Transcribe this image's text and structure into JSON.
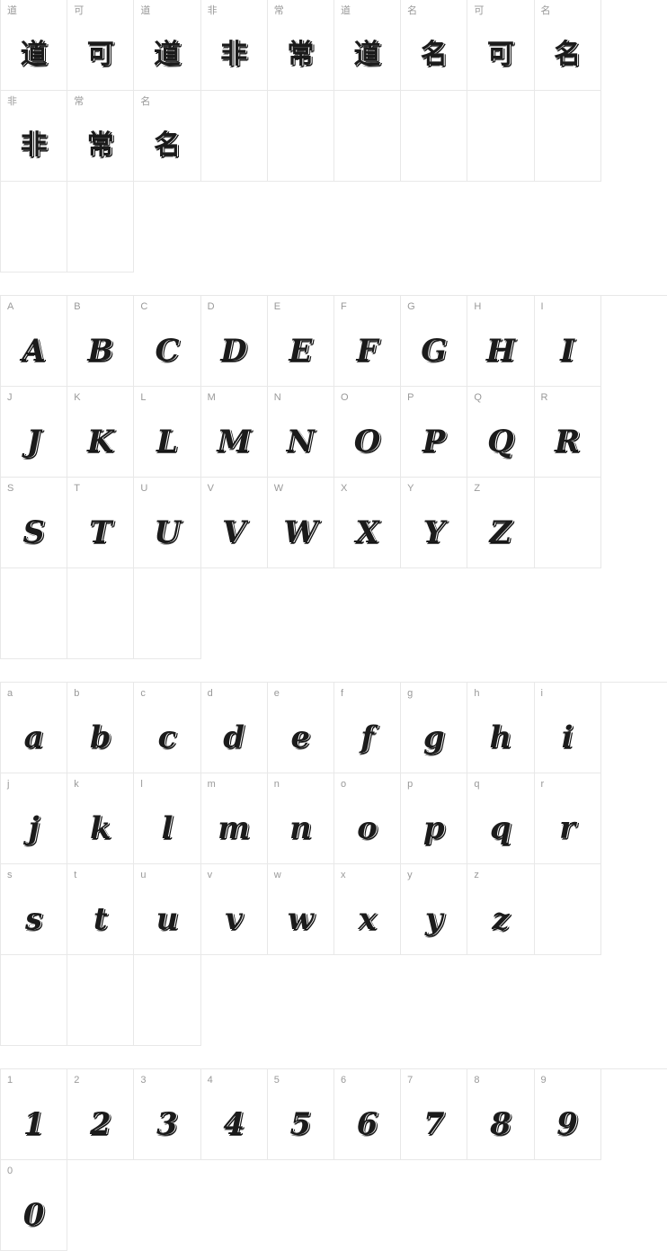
{
  "page": {
    "title": "Font character map preview",
    "background": "#ffffff",
    "grid_line_color": "#e8e8e8",
    "label_color": "#999999",
    "glyph_color": "#1b1b1b"
  },
  "blocks": [
    {
      "name": "cjk-sample-block",
      "columns": 10,
      "cells": [
        {
          "label": "道",
          "glyph": "道",
          "script": "cjk"
        },
        {
          "label": "可",
          "glyph": "可",
          "script": "cjk"
        },
        {
          "label": "道",
          "glyph": "道",
          "script": "cjk"
        },
        {
          "label": "非",
          "glyph": "非",
          "script": "cjk"
        },
        {
          "label": "常",
          "glyph": "常",
          "script": "cjk"
        },
        {
          "label": "道",
          "glyph": "道",
          "script": "cjk"
        },
        {
          "label": "名",
          "glyph": "名",
          "script": "cjk"
        },
        {
          "label": "可",
          "glyph": "可",
          "script": "cjk"
        },
        {
          "label": "名",
          "glyph": "名",
          "script": "cjk"
        },
        {
          "label": "非",
          "glyph": "非",
          "script": "cjk"
        },
        {
          "label": "常",
          "glyph": "常",
          "script": "cjk"
        },
        {
          "label": "名",
          "glyph": "名",
          "script": "cjk"
        },
        {
          "label": "",
          "glyph": "",
          "script": "empty"
        },
        {
          "label": "",
          "glyph": "",
          "script": "empty"
        },
        {
          "label": "",
          "glyph": "",
          "script": "empty"
        },
        {
          "label": "",
          "glyph": "",
          "script": "empty"
        },
        {
          "label": "",
          "glyph": "",
          "script": "empty"
        },
        {
          "label": "",
          "glyph": "",
          "script": "empty"
        },
        {
          "label": "",
          "glyph": "",
          "script": "empty"
        },
        {
          "label": "",
          "glyph": "",
          "script": "empty"
        }
      ]
    },
    {
      "name": "uppercase-block",
      "columns": 10,
      "cells": [
        {
          "label": "A",
          "glyph": "A",
          "script": "latin"
        },
        {
          "label": "B",
          "glyph": "B",
          "script": "latin"
        },
        {
          "label": "C",
          "glyph": "C",
          "script": "latin"
        },
        {
          "label": "D",
          "glyph": "D",
          "script": "latin"
        },
        {
          "label": "E",
          "glyph": "E",
          "script": "latin"
        },
        {
          "label": "F",
          "glyph": "F",
          "script": "latin"
        },
        {
          "label": "G",
          "glyph": "G",
          "script": "latin"
        },
        {
          "label": "H",
          "glyph": "H",
          "script": "latin"
        },
        {
          "label": "I",
          "glyph": "I",
          "script": "latin"
        },
        {
          "label": "J",
          "glyph": "J",
          "script": "latin"
        },
        {
          "label": "K",
          "glyph": "K",
          "script": "latin"
        },
        {
          "label": "L",
          "glyph": "L",
          "script": "latin"
        },
        {
          "label": "M",
          "glyph": "M",
          "script": "latin"
        },
        {
          "label": "N",
          "glyph": "N",
          "script": "latin"
        },
        {
          "label": "O",
          "glyph": "O",
          "script": "latin"
        },
        {
          "label": "P",
          "glyph": "P",
          "script": "latin"
        },
        {
          "label": "Q",
          "glyph": "Q",
          "script": "latin"
        },
        {
          "label": "R",
          "glyph": "R",
          "script": "latin"
        },
        {
          "label": "S",
          "glyph": "S",
          "script": "latin"
        },
        {
          "label": "T",
          "glyph": "T",
          "script": "latin"
        },
        {
          "label": "U",
          "glyph": "U",
          "script": "latin"
        },
        {
          "label": "V",
          "glyph": "V",
          "script": "latin"
        },
        {
          "label": "W",
          "glyph": "W",
          "script": "latin"
        },
        {
          "label": "X",
          "glyph": "X",
          "script": "latin"
        },
        {
          "label": "Y",
          "glyph": "Y",
          "script": "latin"
        },
        {
          "label": "Z",
          "glyph": "Z",
          "script": "latin"
        },
        {
          "label": "",
          "glyph": "",
          "script": "empty"
        },
        {
          "label": "",
          "glyph": "",
          "script": "empty"
        },
        {
          "label": "",
          "glyph": "",
          "script": "empty"
        },
        {
          "label": "",
          "glyph": "",
          "script": "empty"
        }
      ]
    },
    {
      "name": "lowercase-block",
      "columns": 10,
      "cells": [
        {
          "label": "a",
          "glyph": "a",
          "script": "latin"
        },
        {
          "label": "b",
          "glyph": "b",
          "script": "latin"
        },
        {
          "label": "c",
          "glyph": "c",
          "script": "latin"
        },
        {
          "label": "d",
          "glyph": "d",
          "script": "latin"
        },
        {
          "label": "e",
          "glyph": "e",
          "script": "latin"
        },
        {
          "label": "f",
          "glyph": "f",
          "script": "latin"
        },
        {
          "label": "g",
          "glyph": "g",
          "script": "latin"
        },
        {
          "label": "h",
          "glyph": "h",
          "script": "latin"
        },
        {
          "label": "i",
          "glyph": "i",
          "script": "latin"
        },
        {
          "label": "j",
          "glyph": "j",
          "script": "latin"
        },
        {
          "label": "k",
          "glyph": "k",
          "script": "latin"
        },
        {
          "label": "l",
          "glyph": "l",
          "script": "latin"
        },
        {
          "label": "m",
          "glyph": "m",
          "script": "latin"
        },
        {
          "label": "n",
          "glyph": "n",
          "script": "latin"
        },
        {
          "label": "o",
          "glyph": "o",
          "script": "latin"
        },
        {
          "label": "p",
          "glyph": "p",
          "script": "latin"
        },
        {
          "label": "q",
          "glyph": "q",
          "script": "latin"
        },
        {
          "label": "r",
          "glyph": "r",
          "script": "latin"
        },
        {
          "label": "s",
          "glyph": "s",
          "script": "latin"
        },
        {
          "label": "t",
          "glyph": "t",
          "script": "latin"
        },
        {
          "label": "u",
          "glyph": "u",
          "script": "latin"
        },
        {
          "label": "v",
          "glyph": "v",
          "script": "latin"
        },
        {
          "label": "w",
          "glyph": "w",
          "script": "latin"
        },
        {
          "label": "x",
          "glyph": "x",
          "script": "latin"
        },
        {
          "label": "y",
          "glyph": "y",
          "script": "latin"
        },
        {
          "label": "z",
          "glyph": "z",
          "script": "latin"
        },
        {
          "label": "",
          "glyph": "",
          "script": "empty"
        },
        {
          "label": "",
          "glyph": "",
          "script": "empty"
        },
        {
          "label": "",
          "glyph": "",
          "script": "empty"
        },
        {
          "label": "",
          "glyph": "",
          "script": "empty"
        }
      ]
    },
    {
      "name": "digits-block",
      "columns": 10,
      "cells": [
        {
          "label": "1",
          "glyph": "1",
          "script": "latin"
        },
        {
          "label": "2",
          "glyph": "2",
          "script": "latin"
        },
        {
          "label": "3",
          "glyph": "3",
          "script": "latin"
        },
        {
          "label": "4",
          "glyph": "4",
          "script": "latin"
        },
        {
          "label": "5",
          "glyph": "5",
          "script": "latin"
        },
        {
          "label": "6",
          "glyph": "6",
          "script": "latin"
        },
        {
          "label": "7",
          "glyph": "7",
          "script": "latin"
        },
        {
          "label": "8",
          "glyph": "8",
          "script": "latin"
        },
        {
          "label": "9",
          "glyph": "9",
          "script": "latin"
        },
        {
          "label": "0",
          "glyph": "0",
          "script": "latin"
        }
      ]
    }
  ]
}
